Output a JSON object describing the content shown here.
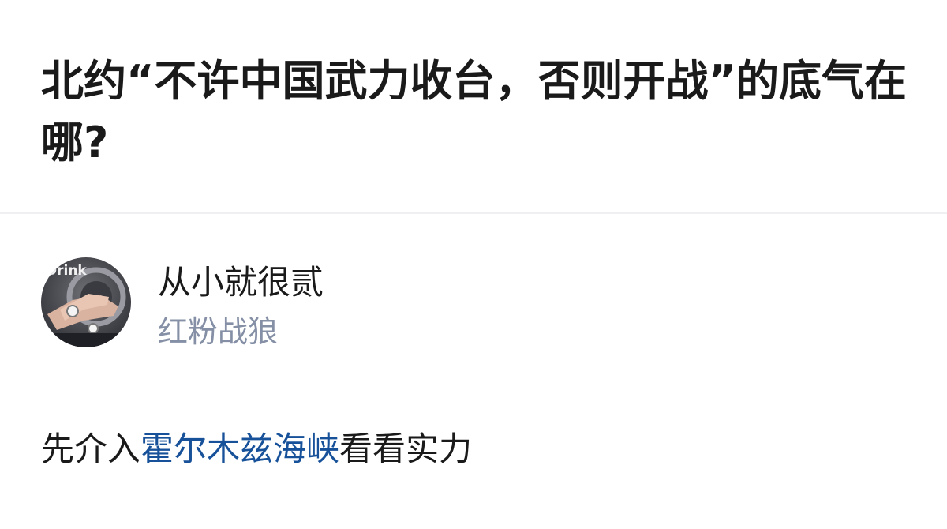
{
  "question": {
    "title": "北约“不许中国武力收台，否则开战”的底气在哪?"
  },
  "answer": {
    "author": {
      "name": "从小就很贰",
      "badge": "红粉战狼",
      "avatar_text": "Drink"
    },
    "content": {
      "before": "先介入",
      "link": "霍尔木兹海峡",
      "after": "看看实力"
    }
  },
  "colors": {
    "link": "#175199",
    "badge": "#8590a6",
    "text": "#1a1a1a"
  }
}
